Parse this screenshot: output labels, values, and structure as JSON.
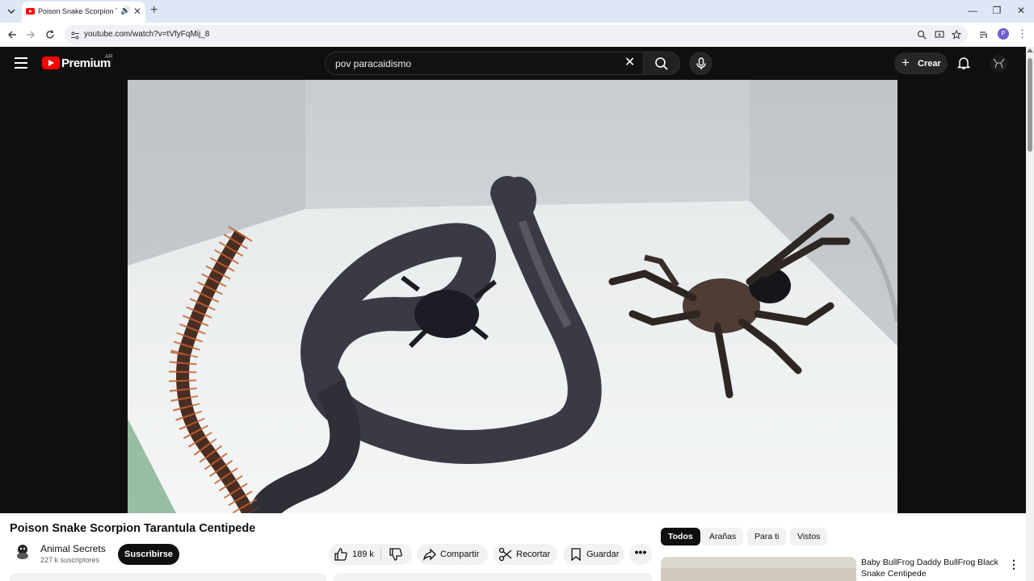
{
  "browser": {
    "tab_title": "Poison Snake Scorpion Tarantula",
    "url": "youtube.com/watch?v=tVfyFqMij_8",
    "profile_initial": "P"
  },
  "youtube": {
    "brand": "Premium",
    "country": "AR",
    "search_query": "pov paracaidismo",
    "create_label": "Crear"
  },
  "video": {
    "title": "Poison Snake Scorpion Tarantula Centipede",
    "channel_name": "Animal Secrets",
    "subscribers": "227 k suscriptores",
    "subscribe_label": "Suscribirse",
    "likes": "189 k",
    "share_label": "Compartir",
    "clip_label": "Recortar",
    "save_label": "Guardar"
  },
  "chips": [
    {
      "label": "Todos",
      "active": true
    },
    {
      "label": "Arañas",
      "active": false
    },
    {
      "label": "Para ti",
      "active": false
    },
    {
      "label": "Vistos",
      "active": false
    }
  ],
  "recommendation": {
    "title": "Baby BullFrog Daddy BullFrog Black Snake Centipede"
  },
  "colors": {
    "yt_red": "#ff0000",
    "masthead": "#0f0f0f",
    "chrome_tabstrip": "#dfe7f7"
  }
}
